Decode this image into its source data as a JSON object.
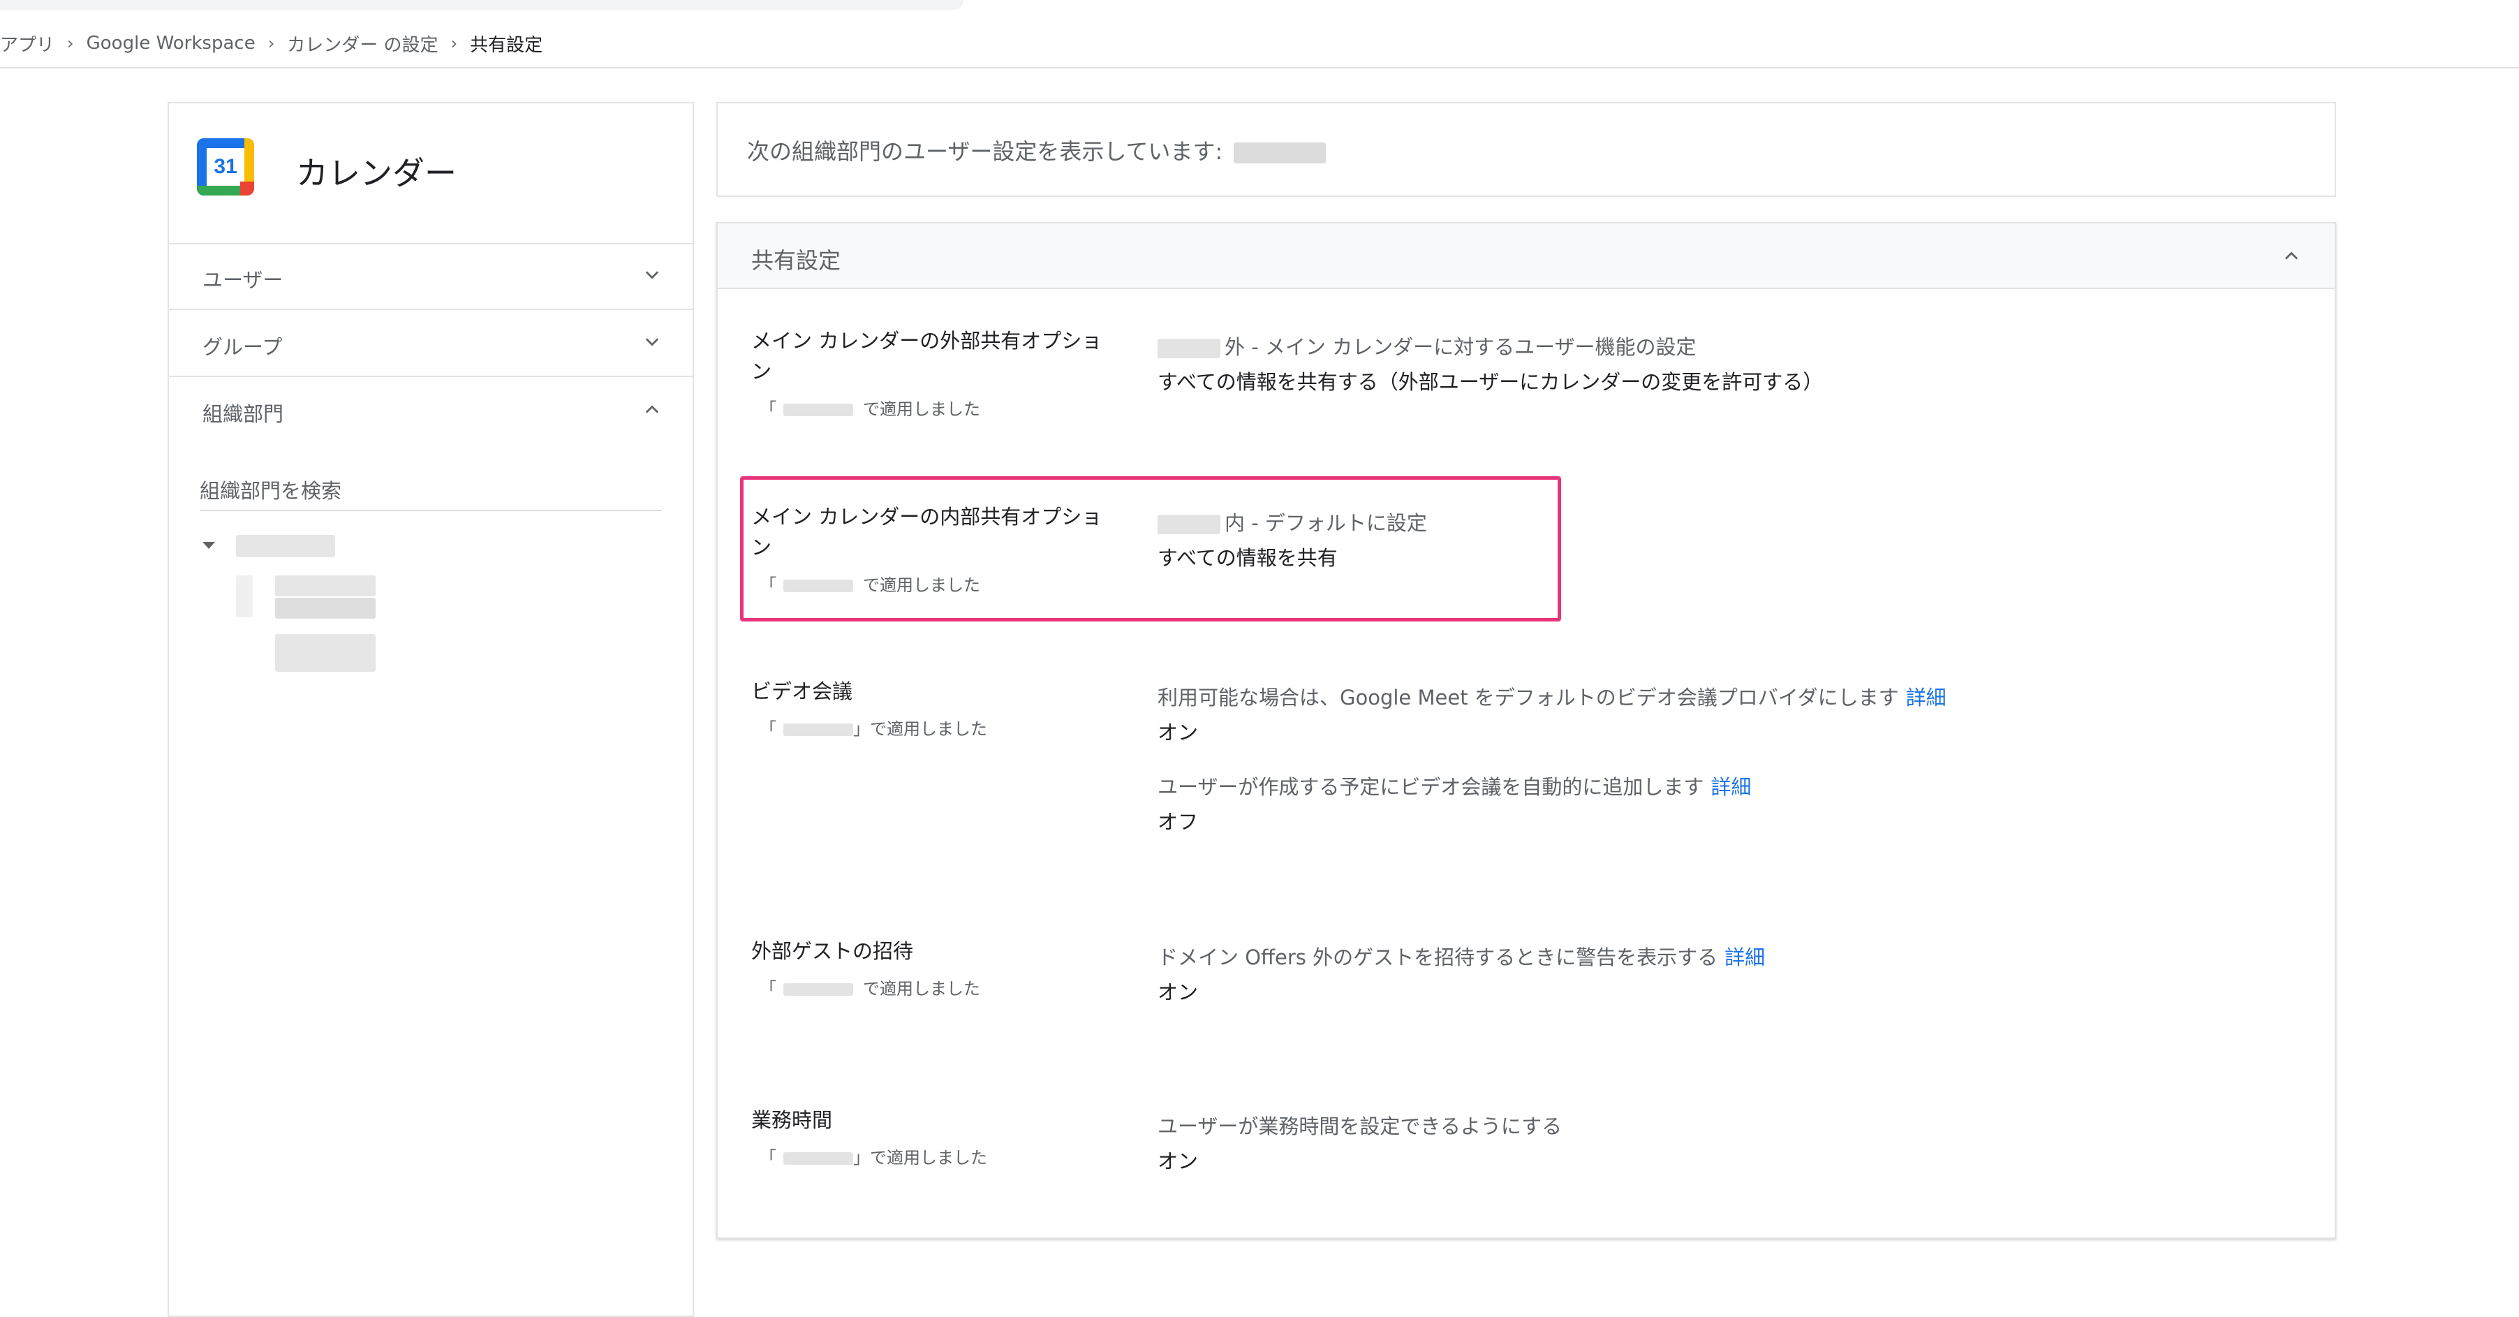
{
  "breadcrumb": {
    "items": [
      "アプリ",
      "Google Workspace",
      "カレンダー の設定",
      "共有設定"
    ]
  },
  "app": {
    "title": "カレンダー",
    "logo_number": "31"
  },
  "nav": {
    "items": [
      {
        "label": "ユーザー",
        "expanded": false
      },
      {
        "label": "グループ",
        "expanded": false
      },
      {
        "label": "組織部門",
        "expanded": true
      }
    ],
    "search_label": "組織部門を検索"
  },
  "info": {
    "text": "次の組織部門のユーザー設定を表示しています:"
  },
  "section": {
    "title": "共有設定",
    "applied_open": "「",
    "applied_suffix": "で適用しました",
    "applied_suffix_alt": "」で適用しました",
    "link_label": "詳細",
    "rows": [
      {
        "name": "メイン カレンダーの外部共有オプション",
        "desc": "外 - メイン カレンダーに対するユーザー機能の設定",
        "value": "すべての情報を共有する（外部ユーザーにカレンダーの変更を許可する）"
      },
      {
        "name": "メイン カレンダーの内部共有オプション",
        "desc": "内 - デフォルトに設定",
        "value": "すべての情報を共有"
      },
      {
        "name": "ビデオ会議",
        "desc": "利用可能な場合は、Google Meet をデフォルトのビデオ会議プロバイダにします",
        "value": "オン",
        "desc2": "ユーザーが作成する予定にビデオ会議を自動的に追加します",
        "value2": "オフ"
      },
      {
        "name": "外部ゲストの招待",
        "desc": "ドメイン Offers 外のゲストを招待するときに警告を表示する",
        "value": "オン"
      },
      {
        "name": "業務時間",
        "desc": "ユーザーが業務時間を設定できるようにする",
        "value": "オン"
      }
    ]
  },
  "colors": {
    "accent": "#1a73e8",
    "highlight": "#ea347a",
    "border": "#e3e3e3"
  }
}
